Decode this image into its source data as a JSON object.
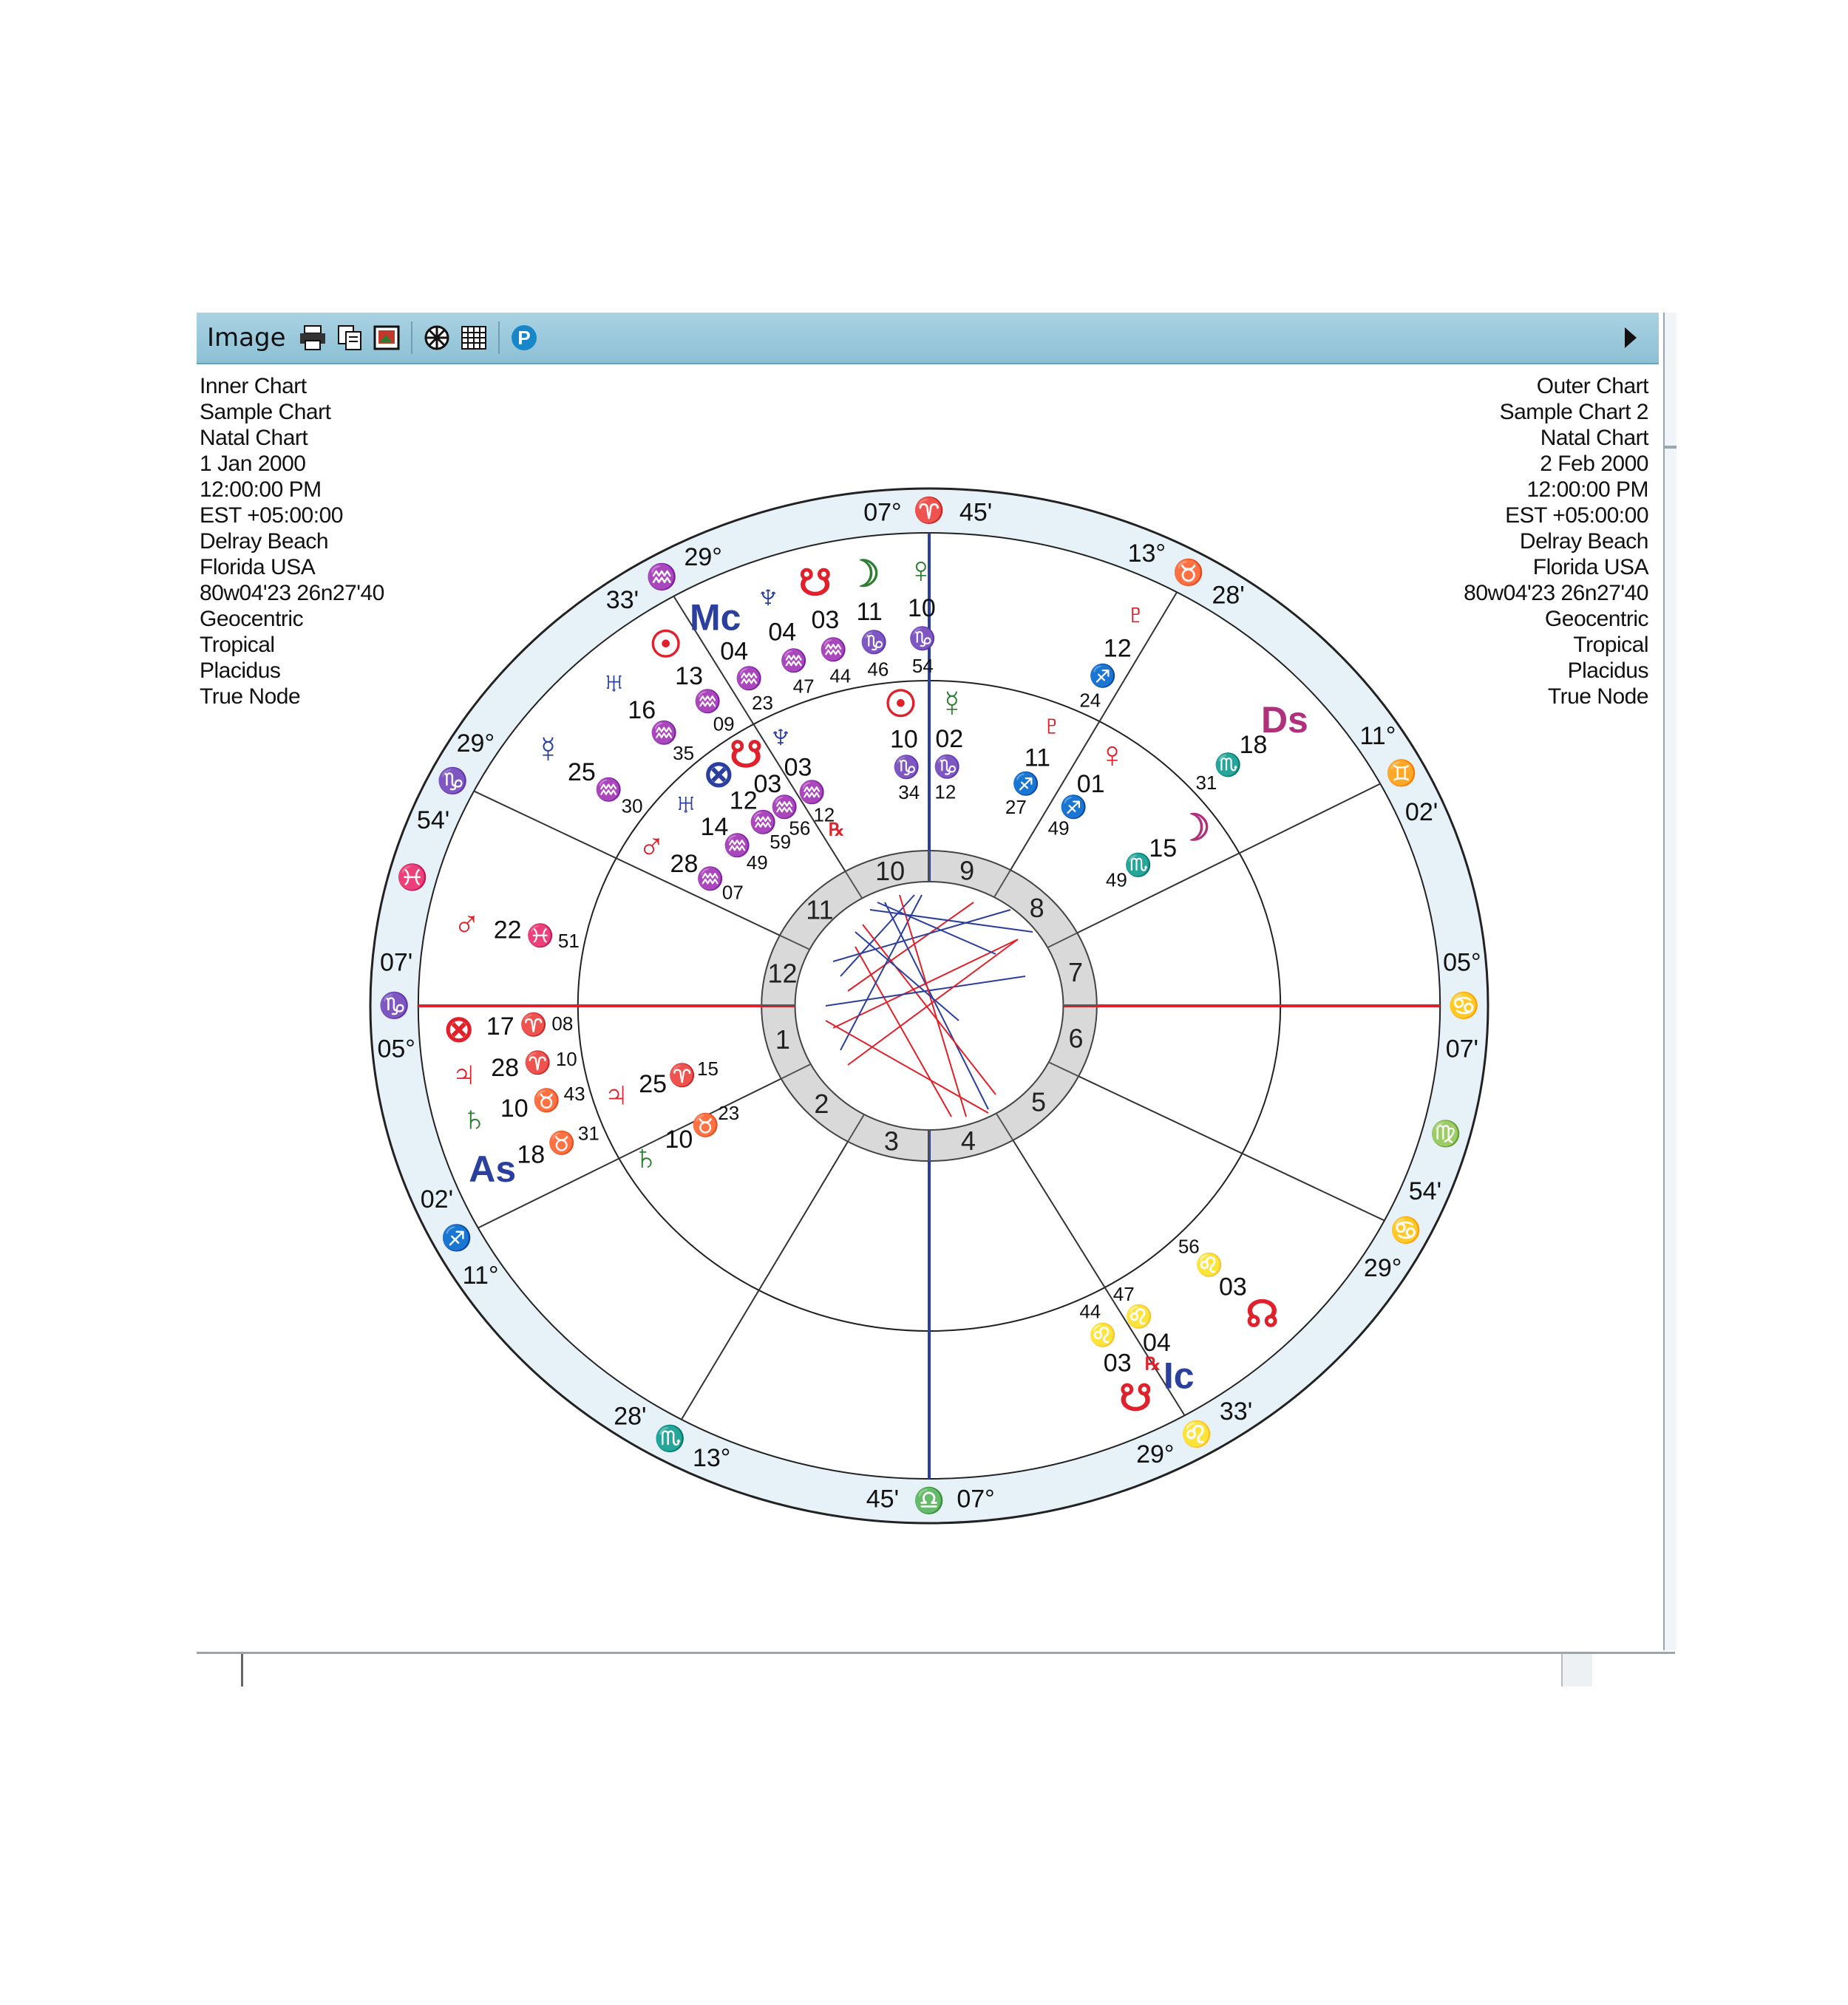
{
  "toolbar": {
    "label": "Image",
    "buttons": [
      {
        "name": "print-icon",
        "glyph": "🖶"
      },
      {
        "name": "copy-icon",
        "glyph": "⎘"
      },
      {
        "name": "export-image-icon",
        "glyph": "▣"
      },
      {
        "name": "wheel-icon",
        "glyph": "✲"
      },
      {
        "name": "grid-icon",
        "glyph": "▦"
      },
      {
        "name": "p-icon",
        "glyph": "P"
      }
    ]
  },
  "inner_chart": {
    "lines": [
      "Inner Chart",
      "Sample Chart",
      "Natal Chart",
      "1 Jan 2000",
      "12:00:00 PM",
      "EST +05:00:00",
      "Delray Beach",
      "Florida USA",
      "80w04'23 26n27'40",
      "Geocentric",
      "Tropical",
      "Placidus",
      "True Node"
    ]
  },
  "outer_chart": {
    "lines": [
      "Outer Chart",
      "Sample Chart 2",
      "Natal Chart",
      "2 Feb 2000",
      "12:00:00 PM",
      "EST +05:00:00",
      "Delray Beach",
      "Florida USA",
      "80w04'23 26n27'40",
      "Geocentric",
      "Tropical",
      "Placidus",
      "True Node"
    ]
  },
  "colors": {
    "fire": "#e0202a",
    "earth": "#2e7d32",
    "air": "#2a3f9e",
    "water": "#b0307c",
    "ring_fill": "#e6f2f8",
    "house_fill": "#d9d9d9",
    "text": "#111111"
  },
  "wheel": {
    "house_numbers": [
      "1",
      "2",
      "3",
      "4",
      "5",
      "6",
      "7",
      "8",
      "9",
      "10",
      "11",
      "12"
    ],
    "cusp_labels": [
      {
        "deg": "05°",
        "sign": "♑",
        "min": "07'",
        "color": "earth"
      },
      {
        "deg": "11°",
        "sign": "♐",
        "min": "02'",
        "color": "fire"
      },
      {
        "deg": "13°",
        "sign": "♏",
        "min": "28'",
        "color": "water"
      },
      {
        "deg": "07°",
        "sign": "♎",
        "min": "45'",
        "color": "air"
      },
      {
        "deg": "33'",
        "sign": "♌",
        "min": "29°",
        "color": "fire"
      },
      {
        "deg": "54'",
        "sign": "♋",
        "min": "29°",
        "color": "water"
      },
      {
        "deg": "05°",
        "sign": "♋",
        "min": "07'",
        "color": "water"
      },
      {
        "deg": "11°",
        "sign": "♊",
        "min": "02'",
        "color": "air"
      },
      {
        "deg": "13°",
        "sign": "♉",
        "min": "28'",
        "color": "earth"
      },
      {
        "deg": "07°",
        "sign": "♈",
        "min": "45'",
        "color": "fire"
      },
      {
        "deg": "33'",
        "sign": "♒",
        "min": "29°",
        "color": "air"
      },
      {
        "deg": "54'",
        "sign": "♑",
        "min": "29°",
        "color": "earth"
      }
    ],
    "intercepted_signs": [
      {
        "sign": "♓",
        "color": "water"
      },
      {
        "sign": "♍",
        "color": "earth"
      }
    ],
    "outer_planets": [
      {
        "glyph": "☽",
        "deg": "11",
        "sign": "♑",
        "min": "46",
        "color": "earth"
      },
      {
        "glyph": "♀",
        "deg": "10",
        "sign": "♑",
        "min": "54",
        "color": "earth"
      },
      {
        "glyph": "♇",
        "deg": "12",
        "sign": "♐",
        "min": "24",
        "color": "fire"
      },
      {
        "glyph": "Ds",
        "deg": "18",
        "sign": "♏",
        "min": "31",
        "color": "water"
      },
      {
        "glyph": "☊",
        "deg": "03",
        "sign": "♌",
        "min": "56",
        "color": "fire"
      },
      {
        "glyph": "Ic",
        "deg": "04",
        "sign": "♌",
        "min": "47",
        "color": "air"
      },
      {
        "glyph": "☋",
        "deg": "03",
        "sign": "♌",
        "min": "44",
        "color": "fire"
      },
      {
        "glyph": "As",
        "deg": "18",
        "sign": "♉",
        "min": "31",
        "color": "air"
      },
      {
        "glyph": "♄",
        "deg": "10",
        "sign": "♉",
        "min": "43",
        "color": "earth"
      },
      {
        "glyph": "♃",
        "deg": "28",
        "sign": "♈",
        "min": "10",
        "color": "fire"
      },
      {
        "glyph": "⊗",
        "deg": "17",
        "sign": "♈",
        "min": "08",
        "color": "fire"
      },
      {
        "glyph": "♂",
        "deg": "22",
        "sign": "♓",
        "min": "51",
        "color": "fire"
      },
      {
        "glyph": "☿",
        "deg": "25",
        "sign": "♒",
        "min": "30",
        "color": "air"
      },
      {
        "glyph": "♅",
        "deg": "16",
        "sign": "♒",
        "min": "35",
        "color": "air"
      },
      {
        "glyph": "☉",
        "deg": "13",
        "sign": "♒",
        "min": "09",
        "color": "fire"
      },
      {
        "glyph": "Mc",
        "deg": "04",
        "sign": "♒",
        "min": "23",
        "color": "air"
      },
      {
        "glyph": "♆",
        "deg": "04",
        "sign": "♒",
        "min": "47",
        "color": "air"
      },
      {
        "glyph": "☋",
        "deg": "03",
        "sign": "♒",
        "min": "44",
        "color": "fire"
      }
    ],
    "inner_planets": [
      {
        "glyph": "☉",
        "deg": "10",
        "sign": "♑",
        "min": "34",
        "color": "fire"
      },
      {
        "glyph": "☿",
        "deg": "02",
        "sign": "♑",
        "min": "12",
        "color": "earth"
      },
      {
        "glyph": "♇",
        "deg": "11",
        "sign": "♐",
        "min": "27",
        "color": "fire"
      },
      {
        "glyph": "♀",
        "deg": "01",
        "sign": "♐",
        "min": "49",
        "color": "fire"
      },
      {
        "glyph": "☽",
        "deg": "15",
        "sign": "♏",
        "min": "49",
        "color": "water"
      },
      {
        "glyph": "♃",
        "deg": "25",
        "sign": "♈",
        "min": "15",
        "color": "fire"
      },
      {
        "glyph": "♄",
        "deg": "10",
        "sign": "♉",
        "min": "23",
        "color": "earth"
      },
      {
        "glyph": "♂",
        "deg": "28",
        "sign": "♒",
        "min": "07",
        "color": "fire"
      },
      {
        "glyph": "♅",
        "deg": "14",
        "sign": "♒",
        "min": "49",
        "color": "air"
      },
      {
        "glyph": "⊗",
        "deg": "12",
        "sign": "♒",
        "min": "59",
        "color": "air"
      },
      {
        "glyph": "☋",
        "deg": "03",
        "sign": "♒",
        "min": "56",
        "color": "fire"
      },
      {
        "glyph": "♆",
        "deg": "03",
        "sign": "♒",
        "min": "12",
        "color": "air"
      }
    ],
    "retrograde_marker": "℞"
  }
}
